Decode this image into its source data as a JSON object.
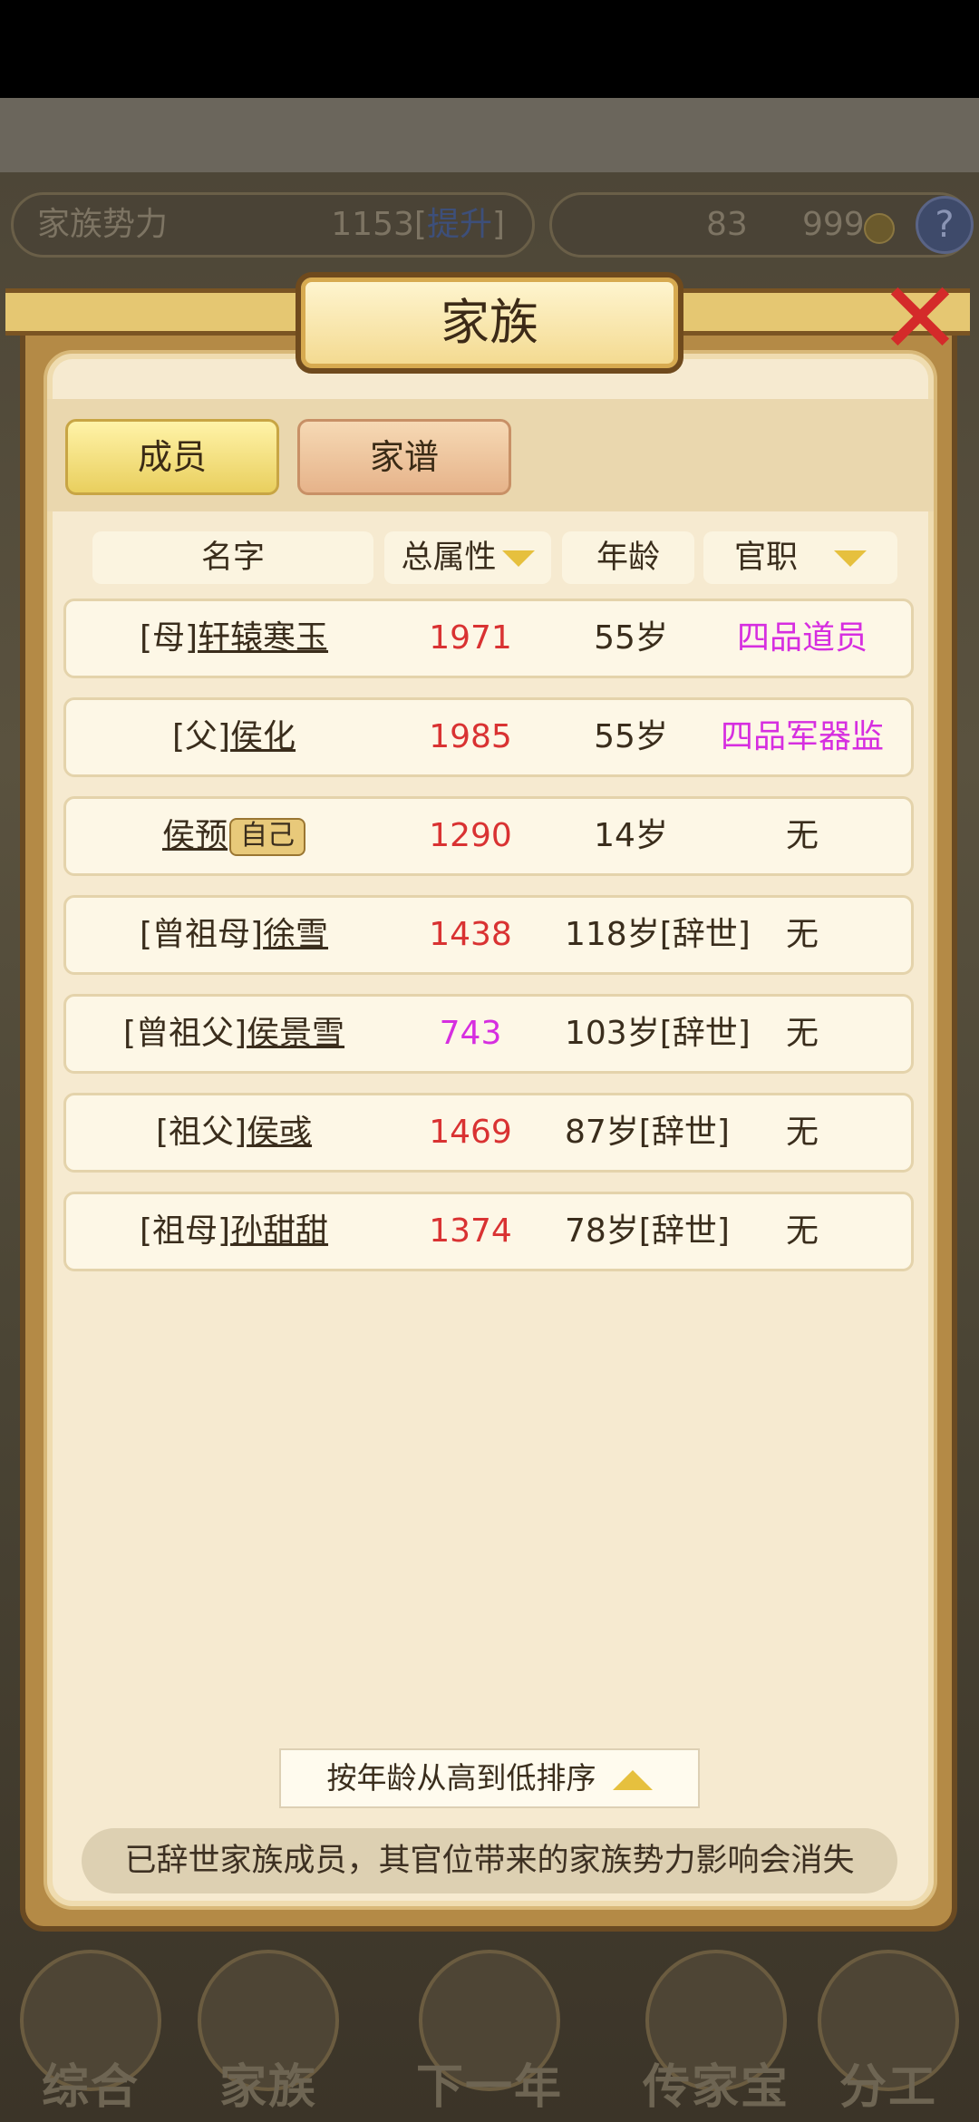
{
  "hud": {
    "power_label": "家族势力",
    "power_value": "1153",
    "power_link": "提升",
    "currency1": "83",
    "currency2": "999",
    "help": "?"
  },
  "modal": {
    "title": "家族",
    "close": "✕",
    "tabs": [
      "成员",
      "家谱"
    ],
    "columns": {
      "name": "名字",
      "attr": "总属性",
      "age": "年龄",
      "post": "官职"
    },
    "rows": [
      {
        "prefix": "[母]",
        "name": "轩辕寒玉",
        "attr": "1971",
        "age": "55岁",
        "post": "四品道员"
      },
      {
        "prefix": "[父]",
        "name": "侯化",
        "attr": "1985",
        "age": "55岁",
        "post": "四品军器监"
      },
      {
        "prefix": "",
        "name": "侯预",
        "tag": "自己",
        "attr": "1290",
        "age": "14岁",
        "post": "无"
      },
      {
        "prefix": "[曾祖母]",
        "name": "徐雪",
        "attr": "1438",
        "age": "118岁[辞世]",
        "post": "无"
      },
      {
        "prefix": "[曾祖父]",
        "name": "侯景雪",
        "attr": "743",
        "age": "103岁[辞世]",
        "post": "无"
      },
      {
        "prefix": "[祖父]",
        "name": "侯彧",
        "attr": "1469",
        "age": "87岁[辞世]",
        "post": "无"
      },
      {
        "prefix": "[祖母]",
        "name": "孙甜甜",
        "attr": "1374",
        "age": "78岁[辞世]",
        "post": "无"
      }
    ],
    "sort_label": "按年龄从高到低排序",
    "notice": "已辞世家族成员，其官位带来的家族势力影响会消失"
  },
  "bottom_nav": [
    "综合",
    "家族",
    "下一年",
    "传家宝",
    "分工"
  ],
  "colors": {
    "attr_red": "#d93232",
    "highlight_purple": "#d62ee0",
    "gold": "#e6c03e"
  }
}
